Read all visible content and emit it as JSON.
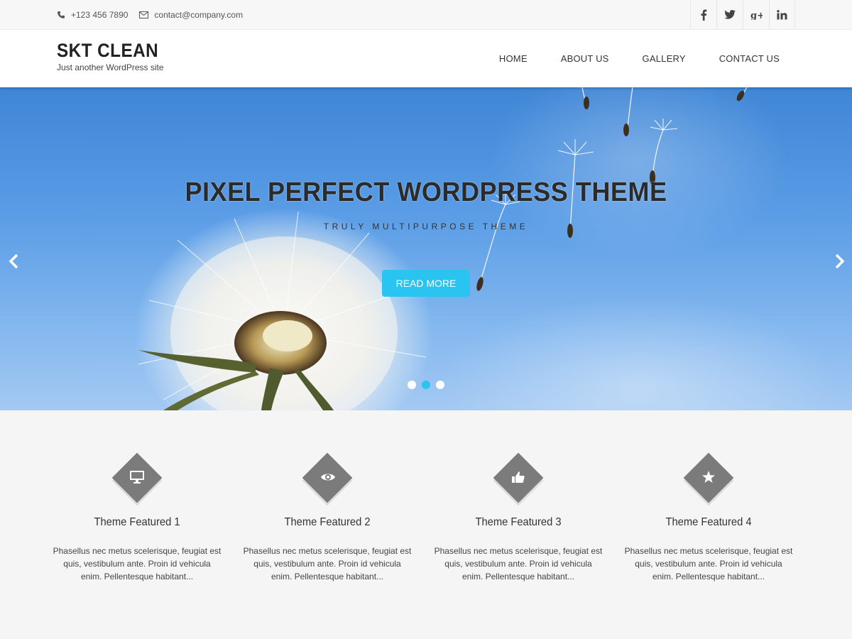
{
  "topbar": {
    "phone": "+123 456 7890",
    "email": "contact@company.com",
    "social": [
      {
        "icon": "facebook-icon",
        "glyph": "f"
      },
      {
        "icon": "twitter-icon",
        "glyph": "t"
      },
      {
        "icon": "google-plus-icon",
        "glyph": "g+"
      },
      {
        "icon": "linkedin-icon",
        "glyph": "in"
      }
    ]
  },
  "header": {
    "site_name": "SKT CLEAN",
    "tagline": "Just another WordPress site",
    "nav": [
      "HOME",
      "ABOUT US",
      "GALLERY",
      "CONTACT US"
    ]
  },
  "hero": {
    "title": "PIXEL PERFECT WORDPRESS THEME",
    "subtitle": "TRULY MULTIPURPOSE THEME",
    "button": "READ MORE",
    "slides": 3,
    "active_slide": 2
  },
  "features": [
    {
      "icon": "monitor-icon",
      "title": "Theme Featured 1",
      "desc": "Phasellus nec metus scelerisque, feugiat est quis, vestibulum ante. Proin id vehicula enim. Pellentesque habitant..."
    },
    {
      "icon": "eye-icon",
      "title": "Theme Featured 2",
      "desc": "Phasellus nec metus scelerisque, feugiat est quis, vestibulum ante. Proin id vehicula enim. Pellentesque habitant..."
    },
    {
      "icon": "thumbs-up-icon",
      "title": "Theme Featured 3",
      "desc": "Phasellus nec metus scelerisque, feugiat est quis, vestibulum ante. Proin id vehicula enim. Pellentesque habitant..."
    },
    {
      "icon": "star-icon",
      "title": "Theme Featured 4",
      "desc": "Phasellus nec metus scelerisque, feugiat est quis, vestibulum ante. Proin id vehicula enim. Pellentesque habitant..."
    }
  ],
  "colors": {
    "accent": "#29c4f0",
    "icon_bg": "#7b7b7b"
  }
}
